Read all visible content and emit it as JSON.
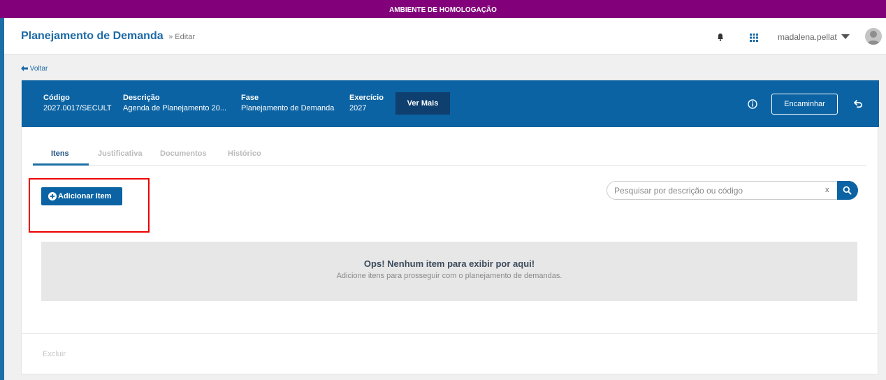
{
  "env_banner": "AMBIENTE DE HOMOLOGAÇÃO",
  "header": {
    "title": "Planejamento de Demanda",
    "breadcrumb_suffix": "» Editar",
    "username": "madalena.pellat"
  },
  "back_link": "Voltar",
  "info": {
    "codigo_label": "Código",
    "codigo_value": "2027.0017/SECULT",
    "descricao_label": "Descrição",
    "descricao_value": "Agenda de Planejamento 20...",
    "fase_label": "Fase",
    "fase_value": "Planejamento de Demanda",
    "exercicio_label": "Exercício",
    "exercicio_value": "2027",
    "ver_mais": "Ver Mais",
    "encaminhar": "Encaminhar"
  },
  "tabs": [
    {
      "label": "Itens",
      "active": true
    },
    {
      "label": "Justificativa",
      "active": false
    },
    {
      "label": "Documentos",
      "active": false
    },
    {
      "label": "Histórico",
      "active": false
    }
  ],
  "add_item_label": "Adicionar Item",
  "search": {
    "placeholder": "Pesquisar por descrição ou código",
    "clear": "x"
  },
  "empty_state": {
    "title": "Ops! Nenhum item para exibir por aqui!",
    "text": "Adicione itens para prosseguir com o planejamento de demandas."
  },
  "footer": {
    "excluir": "Excluir"
  },
  "colors": {
    "env_banner": "#82007a",
    "primary": "#0b63a3",
    "title": "#1c6aa6",
    "highlight": "#ee0000"
  },
  "icons": [
    "bell-icon",
    "apps-grid-icon",
    "caret-down-icon",
    "avatar-icon",
    "arrow-left-icon",
    "info-icon",
    "undo-icon",
    "plus-circle-icon",
    "search-icon"
  ]
}
